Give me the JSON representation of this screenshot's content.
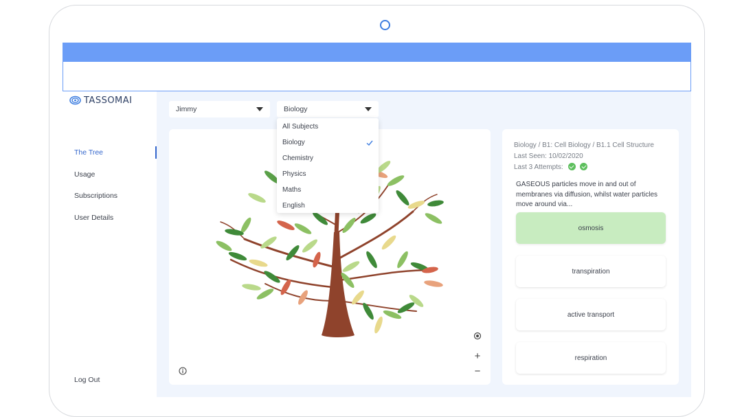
{
  "brand": {
    "name": "TASSOMAI"
  },
  "nav": {
    "items": [
      {
        "label": "The Tree"
      },
      {
        "label": "Usage"
      },
      {
        "label": "Subscriptions"
      },
      {
        "label": "User Details"
      }
    ],
    "logout": "Log Out",
    "active_index": 0
  },
  "filters": {
    "student": "Jimmy",
    "subject": "Biology",
    "subject_options": [
      "All Subjects",
      "Biology",
      "Chemistry",
      "Physics",
      "Maths",
      "English"
    ],
    "selected_option": "Biology"
  },
  "map_controls": {
    "locate": "locate-icon",
    "zoom_in": "+",
    "zoom_out": "−",
    "info": "info-icon"
  },
  "question_panel": {
    "breadcrumb": "Biology / B1: Cell Biology / B1.1 Cell Structure",
    "last_seen": "Last Seen: 10/02/2020",
    "last_attempts_label": "Last 3 Attempts:",
    "attempts_shown": 2,
    "question": "GASEOUS particles move in and out of membranes via diffusion, whilst water particles move around via...",
    "answers": [
      {
        "text": "osmosis",
        "correct": true
      },
      {
        "text": "transpiration",
        "correct": false
      },
      {
        "text": "active transport",
        "correct": false
      },
      {
        "text": "respiration",
        "correct": false
      }
    ]
  },
  "colors": {
    "accent": "#3366cc",
    "header_bar": "#6b9df7",
    "correct_bg": "#c8ecc0",
    "tick_green": "#5dbf5d",
    "trunk": "#8f432c"
  }
}
